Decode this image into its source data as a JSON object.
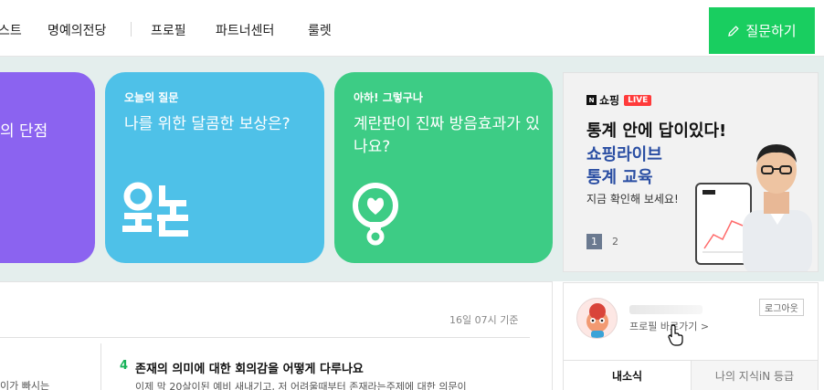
{
  "nav": {
    "items": [
      "스트",
      "명예의전당",
      "프로필",
      "파트너센터",
      "룰렛"
    ],
    "ask_button": "질문하기",
    "accent_color": "#19ce60"
  },
  "cards": [
    {
      "tag": "",
      "title": "의 단점",
      "color": "#8b63f0"
    },
    {
      "tag": "오늘의 질문",
      "title": "나를 위한 달콤한 보상은?",
      "color": "#4ec1e8",
      "icon": "oneul-logo-icon"
    },
    {
      "tag": "아하! 그렇구나",
      "title": "계란판이 진짜 방음효과가 있나요?",
      "color": "#3dcc85",
      "icon": "lightbulb-heart-icon"
    }
  ],
  "ad": {
    "brand": "쇼핑",
    "brand_badge": "N",
    "live": "LIVE",
    "line1": "통계 안에 답이있다!",
    "line2": "쇼핑라이브",
    "line3": "통계 교육",
    "line4": "지금 확인해 보세요!",
    "pages": [
      "1",
      "2"
    ],
    "active_page": 1
  },
  "ranking": {
    "timestamp": "16일 07시 기준",
    "left_snippet": "이가 빠시는",
    "item": {
      "rank": "4",
      "title": "존재의 의미에 대한 회의감을 어떻게 다루나요",
      "snippet": "이제 막 20살이된 예비 새내기고, 저 어려울때부터 존재라는주제에 대한 의문이"
    }
  },
  "profile": {
    "profile_link": "프로필 바로가기 >",
    "logout": "로그아웃",
    "tabs": [
      "내소식",
      "나의 지식iN 등급"
    ]
  }
}
